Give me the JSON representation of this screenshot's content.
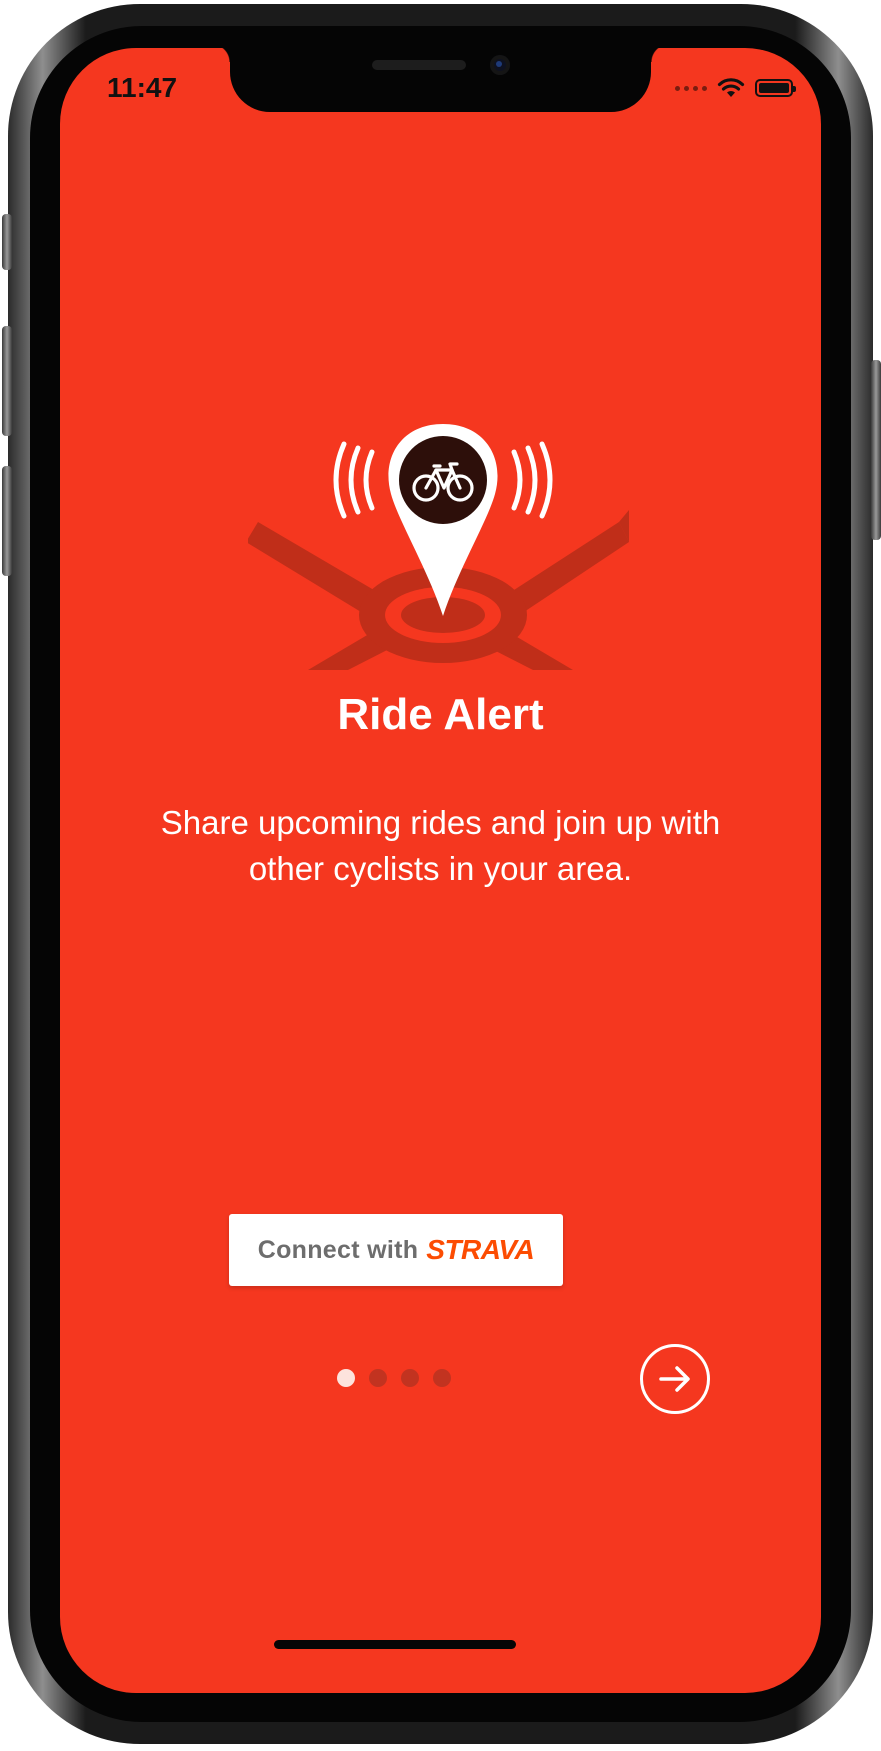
{
  "status_bar": {
    "time": "11:47"
  },
  "onboarding": {
    "title": "Ride Alert",
    "description": "Share upcoming rides and join up with other cyclists in your area.",
    "connect_button": {
      "prefix": "Connect with",
      "brand": "STRAVA"
    },
    "page_indicator": {
      "total": 4,
      "current": 1
    }
  },
  "icons": {
    "illustration": "ride-alert-bike-pin",
    "next": "arrow-right-circle",
    "wifi": "wifi",
    "battery": "battery-full"
  },
  "colors": {
    "background": "#f5371f",
    "text": "#ffffff",
    "pin_circle": "#2d0f0a",
    "brand": "#fc4c02"
  }
}
